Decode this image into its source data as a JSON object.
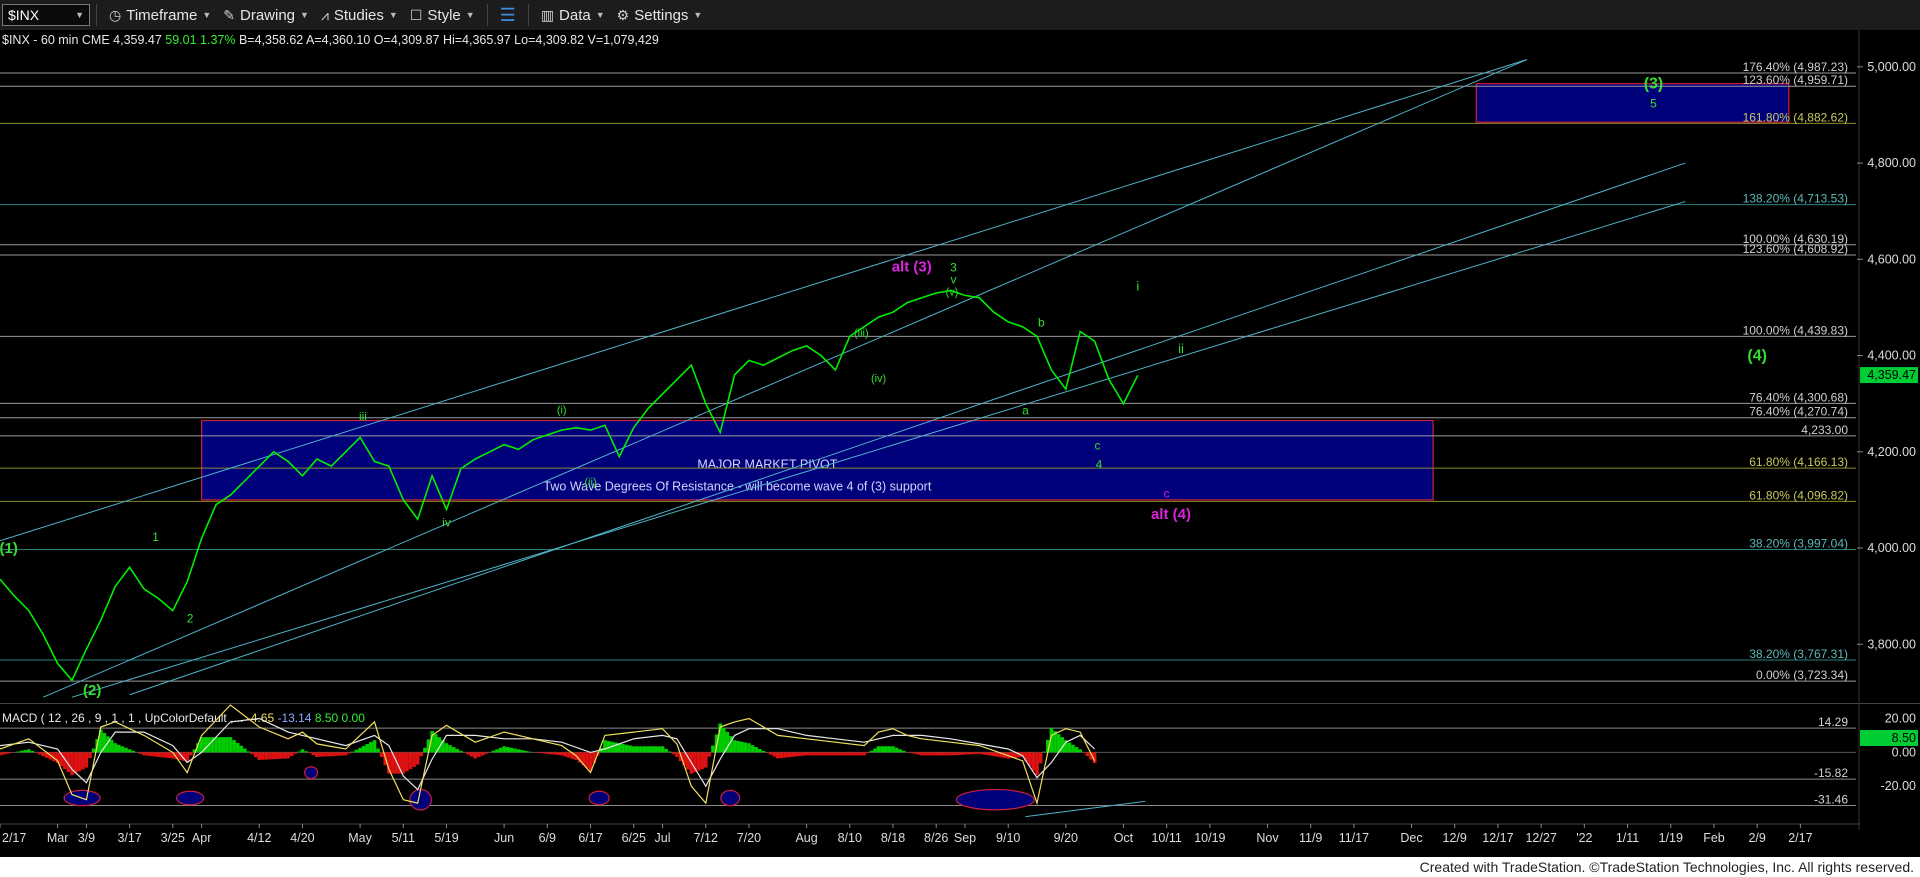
{
  "toolbar": {
    "symbol": "$INX",
    "timeframe": "Timeframe",
    "drawing": "Drawing",
    "studies": "Studies",
    "style": "Style",
    "data": "Data",
    "settings": "Settings"
  },
  "footer": "Created with TradeStation. ©TradeStation Technologies, Inc. All rights reserved.",
  "colors": {
    "price": "#00ee00",
    "channel": "#4fb3c8",
    "fib_white": "#9a9a9a",
    "fib_olive": "#8a8a2a",
    "fib_teal": "#2a7f7f",
    "box_fill": "#00007a",
    "box_border": "#cc1f3a",
    "wave_green": "#33dd33",
    "wave_magenta": "#dd22dd",
    "macd_line": "#f0e060",
    "signal_line": "#e8e8e8",
    "hist_pos": "#00cc00",
    "hist_neg": "#dd1111"
  },
  "chart_data": {
    "type": "line",
    "header": {
      "symbol": "$INX",
      "interval": "60 min",
      "exchange": "CME",
      "last": "4,359.47",
      "change": "59.01",
      "change_pct": "1.37%",
      "bid": "B=4,358.62",
      "ask": "A=4,360.10",
      "open": "O=4,309.87",
      "high": "Hi=4,365.97",
      "low": "Lo=4,309.82",
      "volume": "V=1,079,429"
    },
    "ylim": [
      3680,
      5035
    ],
    "y_ticks": [
      "5,000.00",
      "4,800.00",
      "4,600.00",
      "4,400.00",
      "4,200.00",
      "4,000.00",
      "3,800.00"
    ],
    "y_tick_values": [
      5000,
      4800,
      4600,
      4400,
      4200,
      4000,
      3800
    ],
    "last_price": "4,359.47",
    "last_value": 4359.47,
    "x_ticks": [
      "2/17",
      "Mar",
      "3/9",
      "3/17",
      "3/25",
      "Apr",
      "4/12",
      "4/20",
      "May",
      "5/11",
      "5/19",
      "Jun",
      "6/9",
      "6/17",
      "6/25",
      "Jul",
      "7/12",
      "7/20",
      "Aug",
      "8/10",
      "8/18",
      "8/26",
      "Sep",
      "9/10",
      "9/20",
      "Oct",
      "10/11",
      "10/19",
      "Nov",
      "11/9",
      "11/17",
      "Dec",
      "12/9",
      "12/17",
      "12/27",
      "'22",
      "1/11",
      "1/19",
      "Feb",
      "2/9",
      "2/17"
    ],
    "x_tick_index": [
      0,
      4,
      6,
      9,
      12,
      14,
      18,
      21,
      25,
      28,
      31,
      35,
      38,
      41,
      44,
      46,
      49,
      52,
      56,
      59,
      62,
      65,
      67,
      70,
      74,
      78,
      81,
      84,
      88,
      91,
      94,
      98,
      101,
      104,
      107,
      110,
      113,
      116,
      119,
      122,
      125
    ],
    "x_last_index": 129,
    "price_series": {
      "x": [
        0,
        1,
        2,
        3,
        4,
        5,
        6,
        7,
        8,
        9,
        10,
        11,
        12,
        13,
        14,
        15,
        16,
        17,
        18,
        19,
        20,
        21,
        22,
        23,
        24,
        25,
        26,
        27,
        28,
        29,
        30,
        31,
        32,
        33,
        34,
        35,
        36,
        37,
        38,
        39,
        40,
        41,
        42,
        43,
        44,
        45,
        46,
        47,
        48,
        49,
        50,
        51,
        52,
        53,
        54,
        55,
        56,
        57,
        58,
        59,
        60,
        61,
        62,
        63,
        64,
        65,
        66,
        67,
        68,
        69,
        70,
        71,
        72,
        73,
        74,
        75,
        76,
        77,
        78,
        79
      ],
      "y": [
        3935,
        3900,
        3870,
        3820,
        3760,
        3725,
        3790,
        3850,
        3920,
        3960,
        3915,
        3895,
        3870,
        3930,
        4020,
        4090,
        4110,
        4140,
        4170,
        4200,
        4180,
        4150,
        4185,
        4170,
        4200,
        4230,
        4180,
        4170,
        4100,
        4060,
        4150,
        4080,
        4165,
        4185,
        4200,
        4215,
        4205,
        4225,
        4235,
        4245,
        4250,
        4245,
        4255,
        4190,
        4250,
        4290,
        4320,
        4350,
        4380,
        4300,
        4240,
        4360,
        4390,
        4380,
        4395,
        4410,
        4420,
        4400,
        4370,
        4440,
        4460,
        4480,
        4490,
        4510,
        4520,
        4530,
        4535,
        4525,
        4520,
        4490,
        4470,
        4460,
        4440,
        4370,
        4330,
        4450,
        4430,
        4350,
        4300,
        4359
      ]
    },
    "price_series_note": "",
    "fib_levels": [
      {
        "label": "176.40% (4,987.23)",
        "value": 4987.23,
        "color": "#9a9a9a"
      },
      {
        "label": "123.60% (4,959.71)",
        "value": 4959.71,
        "color": "#9a9a9a"
      },
      {
        "label": "161.80% (4,882.62)",
        "value": 4882.62,
        "color": "#8a8a2a"
      },
      {
        "label": "138.20% (4,713.53)",
        "value": 4713.53,
        "color": "#2a7f7f"
      },
      {
        "label": "100.00% (4,630.19)",
        "value": 4630.19,
        "color": "#9a9a9a"
      },
      {
        "label": "123.60% (4,608.92)",
        "value": 4608.92,
        "color": "#9a9a9a"
      },
      {
        "label": "100.00% (4,439.83)",
        "value": 4439.83,
        "color": "#9a9a9a"
      },
      {
        "label": "76.40% (4,300.68)",
        "value": 4300.68,
        "color": "#9a9a9a"
      },
      {
        "label": "76.40% (4,270.74)",
        "value": 4270.74,
        "color": "#9a9a9a"
      },
      {
        "label": "4,233.00",
        "value": 4233.0,
        "color": "#9a9a9a"
      },
      {
        "label": "61.80% (4,166.13)",
        "value": 4166.13,
        "color": "#8a8a2a"
      },
      {
        "label": "61.80% (4,096.82)",
        "value": 4096.82,
        "color": "#8a8a2a"
      },
      {
        "label": "38.20% (3,997.04)",
        "value": 3997.04,
        "color": "#2a7f7f"
      },
      {
        "label": "38.20% (3,767.31)",
        "value": 3767.31,
        "color": "#2a7f7f"
      },
      {
        "label": "0.00% (3,723.34)",
        "value": 3723.34,
        "color": "#9a9a9a"
      }
    ],
    "channels": [
      {
        "x1": 3,
        "y1": 3690,
        "x2": 106,
        "y2": 5015
      },
      {
        "x1": 9,
        "y1": 3695,
        "x2": 117,
        "y2": 4800
      },
      {
        "x1": 5,
        "y1": 3690,
        "x2": 117,
        "y2": 4720
      },
      {
        "x1": 0,
        "y1": 4015,
        "x2": 106,
        "y2": 5015
      }
    ],
    "zones": [
      {
        "x1": 14,
        "x2": 99.5,
        "y1": 4265,
        "y2": 4100,
        "labels": [
          "MAJOR MARKET PIVOT",
          "Two Wave Degrees Of Resistance - will become wave 4 of (3) support"
        ]
      },
      {
        "x1": 102.5,
        "x2": 124.2,
        "y1": 4965,
        "y2": 4885,
        "labels": []
      }
    ],
    "wave_labels": [
      {
        "text": "(1)",
        "x": 0.6,
        "y": 3990,
        "color": "#33dd33",
        "size": 15
      },
      {
        "text": "(2)",
        "x": 6.4,
        "y": 3695,
        "color": "#33dd33",
        "size": 15
      },
      {
        "text": "1",
        "x": 10.8,
        "y": 4015,
        "color": "#33dd33",
        "size": 12
      },
      {
        "text": "2",
        "x": 13.2,
        "y": 3845,
        "color": "#33dd33",
        "size": 12
      },
      {
        "text": "iii",
        "x": 25.2,
        "y": 4265,
        "color": "#33dd33",
        "size": 12
      },
      {
        "text": "iv",
        "x": 31.0,
        "y": 4045,
        "color": "#33dd33",
        "size": 12
      },
      {
        "text": "(i)",
        "x": 39.0,
        "y": 4280,
        "color": "#33dd33",
        "size": 11
      },
      {
        "text": "(ii)",
        "x": 41.0,
        "y": 4130,
        "color": "#33dd33",
        "size": 11
      },
      {
        "text": "(iii)",
        "x": 59.8,
        "y": 4440,
        "color": "#33dd33",
        "size": 11
      },
      {
        "text": "(iv)",
        "x": 61.0,
        "y": 4345,
        "color": "#33dd33",
        "size": 11
      },
      {
        "text": "alt (3)",
        "x": 63.3,
        "y": 4575,
        "color": "#dd22dd",
        "size": 15
      },
      {
        "text": "3",
        "x": 66.2,
        "y": 4575,
        "color": "#33dd33",
        "size": 12
      },
      {
        "text": "v",
        "x": 66.2,
        "y": 4550,
        "color": "#33dd33",
        "size": 12
      },
      {
        "text": "(v)",
        "x": 66.1,
        "y": 4525,
        "color": "#33dd33",
        "size": 11
      },
      {
        "text": "b",
        "x": 72.3,
        "y": 4460,
        "color": "#33dd33",
        "size": 12
      },
      {
        "text": "a",
        "x": 71.2,
        "y": 4278,
        "color": "#33dd33",
        "size": 12
      },
      {
        "text": "c",
        "x": 76.2,
        "y": 4205,
        "color": "#33dd33",
        "size": 12
      },
      {
        "text": "4",
        "x": 76.3,
        "y": 4165,
        "color": "#33dd33",
        "size": 12
      },
      {
        "text": "c",
        "x": 81.0,
        "y": 4105,
        "color": "#dd22dd",
        "size": 12
      },
      {
        "text": "alt (4)",
        "x": 81.3,
        "y": 4060,
        "color": "#dd22dd",
        "size": 15
      },
      {
        "text": "i",
        "x": 79.0,
        "y": 4535,
        "color": "#33dd33",
        "size": 13
      },
      {
        "text": "ii",
        "x": 82.0,
        "y": 4405,
        "color": "#33dd33",
        "size": 13
      },
      {
        "text": "(3)",
        "x": 114.8,
        "y": 4955,
        "color": "#33dd33",
        "size": 16
      },
      {
        "text": "5",
        "x": 114.8,
        "y": 4915,
        "color": "#33dd33",
        "size": 12
      },
      {
        "text": "(4)",
        "x": 122.0,
        "y": 4390,
        "color": "#33dd33",
        "size": 16
      }
    ],
    "macd": {
      "label": "MACD ( 12 , 26 , 9 , 1 , 1 , UpColorDefault ,... ",
      "values": [
        "-4.65",
        "-13.14",
        "8.50",
        "0.00"
      ],
      "value_colors": [
        "#f0e060",
        "#8fa8ff",
        "#33ee33",
        "#33ee33"
      ],
      "ylim": [
        -40,
        28
      ],
      "y_ticks": [
        "20.00",
        "0.00",
        "-20.00"
      ],
      "y_tick_values": [
        20,
        0,
        -20
      ],
      "level_labels": [
        "14.29",
        "-15.82",
        "-31.46"
      ],
      "level_values": [
        14.29,
        -15.82,
        -31.46
      ],
      "last_value": "8.50",
      "last_num": 8.5,
      "macd_line": {
        "x": [
          0,
          2,
          4,
          5,
          6,
          7,
          8,
          10,
          12,
          13,
          14,
          16,
          18,
          20,
          21,
          22,
          24,
          26,
          27,
          28,
          29,
          30,
          31,
          33,
          35,
          37,
          39,
          40,
          41,
          42,
          44,
          46,
          47,
          48,
          49,
          50,
          51,
          52,
          54,
          56,
          58,
          60,
          61,
          62,
          63,
          64,
          66,
          68,
          70,
          71,
          72,
          73,
          74,
          75,
          76
        ],
        "y": [
          2,
          8,
          -5,
          -25,
          -28,
          15,
          18,
          10,
          0,
          -12,
          10,
          28,
          15,
          8,
          12,
          5,
          2,
          18,
          -10,
          -28,
          -30,
          10,
          16,
          6,
          12,
          8,
          4,
          -2,
          -12,
          10,
          12,
          14,
          5,
          -20,
          -30,
          15,
          18,
          20,
          10,
          8,
          6,
          4,
          12,
          14,
          10,
          8,
          6,
          4,
          -2,
          -5,
          -30,
          10,
          14,
          12,
          -5
        ]
      },
      "signal_line": {
        "x": [
          0,
          2,
          4,
          5,
          6,
          7,
          8,
          10,
          12,
          13,
          14,
          16,
          18,
          20,
          22,
          24,
          26,
          27,
          28,
          29,
          30,
          31,
          33,
          35,
          37,
          39,
          41,
          42,
          44,
          46,
          47,
          48,
          49,
          50,
          51,
          52,
          54,
          56,
          58,
          60,
          62,
          64,
          66,
          68,
          70,
          71,
          72,
          73,
          74,
          75,
          76
        ],
        "y": [
          4,
          6,
          2,
          -10,
          -18,
          0,
          12,
          12,
          4,
          -6,
          0,
          18,
          20,
          12,
          8,
          4,
          10,
          4,
          -14,
          -22,
          -4,
          10,
          10,
          8,
          8,
          6,
          0,
          2,
          8,
          10,
          8,
          -6,
          -20,
          -4,
          10,
          14,
          14,
          10,
          8,
          6,
          10,
          10,
          8,
          5,
          2,
          -2,
          -15,
          -6,
          6,
          10,
          2
        ]
      },
      "histogram_note": "",
      "divergence_ellipses": [
        {
          "x": 5.7,
          "y": -27,
          "w": 2.5,
          "h": 9
        },
        {
          "x": 13.2,
          "y": -27,
          "w": 1.9,
          "h": 8
        },
        {
          "x": 21.6,
          "y": -12,
          "w": 0.9,
          "h": 7
        },
        {
          "x": 29.2,
          "y": -28,
          "w": 1.5,
          "h": 12
        },
        {
          "x": 41.6,
          "y": -27,
          "w": 1.4,
          "h": 8
        },
        {
          "x": 50.7,
          "y": -27,
          "w": 1.3,
          "h": 9
        },
        {
          "x": 69.1,
          "y": -28,
          "w": 5.4,
          "h": 12
        }
      ],
      "trend_line": {
        "x1": 71.2,
        "y1": -38,
        "x2": 79.5,
        "y2": -29
      }
    }
  }
}
